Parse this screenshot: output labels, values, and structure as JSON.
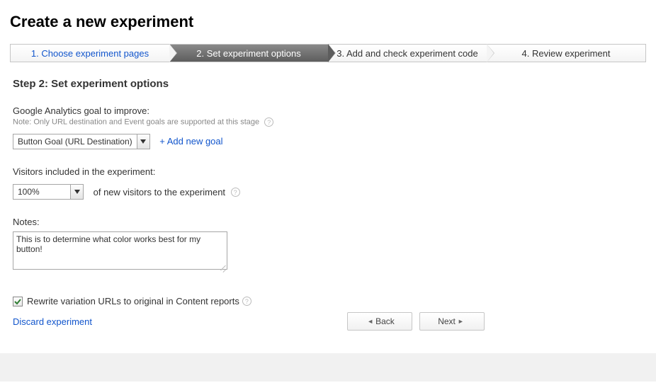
{
  "page_title": "Create a new experiment",
  "steps": [
    {
      "label": "1. Choose experiment pages"
    },
    {
      "label": "2. Set experiment options"
    },
    {
      "label": "3. Add and check experiment code"
    },
    {
      "label": "4. Review experiment"
    }
  ],
  "section_title": "Step 2: Set experiment options",
  "goal": {
    "label": "Google Analytics goal to improve:",
    "note": "Note: Only URL destination and Event goals are supported at this stage",
    "selected": "Button Goal (URL Destination)",
    "add_link": "+ Add new goal"
  },
  "visitors": {
    "label": "Visitors included in the experiment:",
    "selected": "100%",
    "suffix": "of new visitors to the experiment"
  },
  "notes": {
    "label": "Notes:",
    "value": "This is to determine what color works best for my button!"
  },
  "rewrite": {
    "checked": true,
    "label": "Rewrite variation URLs to original in Content reports"
  },
  "footer": {
    "discard": "Discard experiment",
    "back": "Back",
    "next": "Next"
  }
}
